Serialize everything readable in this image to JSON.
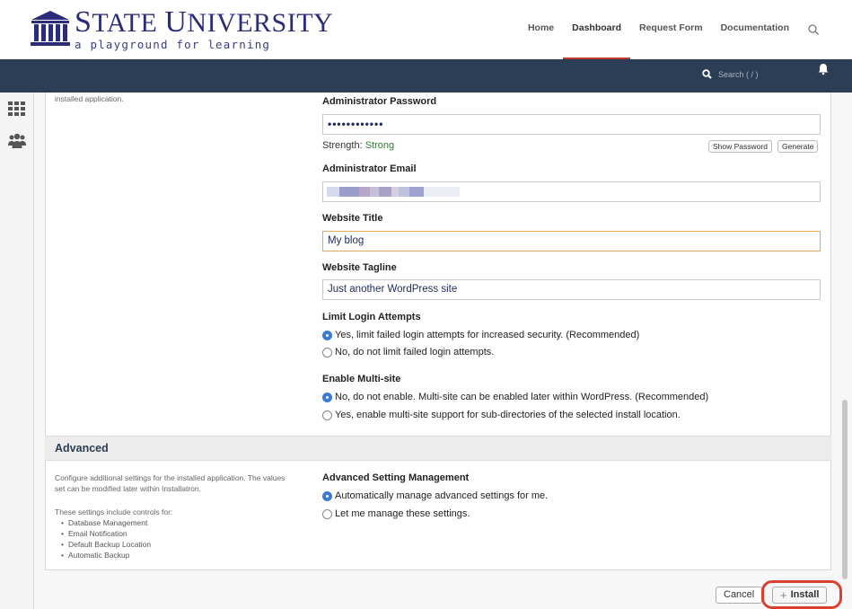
{
  "header": {
    "logo_title_first_big": "S",
    "logo_title_first_rest": "TATE ",
    "logo_title_second_big": "U",
    "logo_title_second_rest": "NIVERSITY",
    "logo_subtitle": "a playground for learning",
    "nav": [
      "Home",
      "Dashboard",
      "Request Form",
      "Documentation"
    ],
    "active_nav": "Dashboard"
  },
  "toolbar": {
    "search_label": "Search ( / )"
  },
  "form": {
    "top_left_note": "installed application.",
    "admin_password_label": "Administrator Password",
    "admin_password_value": "••••••••••••",
    "strength_prefix": "Strength:",
    "strength_value": "Strong",
    "show_password_label": "Show Password",
    "generate_label": "Generate",
    "admin_email_label": "Administrator Email",
    "website_title_label": "Website Title",
    "website_title_value": "My blog",
    "website_tagline_label": "Website Tagline",
    "website_tagline_value": "Just another WordPress site",
    "limit_login_label": "Limit Login Attempts",
    "limit_login_options": [
      "Yes, limit failed login attempts for increased security. (Recommended)",
      "No, do not limit failed login attempts."
    ],
    "multisite_label": "Enable Multi-site",
    "multisite_options": [
      "No, do not enable. Multi-site can be enabled later within WordPress. (Recommended)",
      "Yes, enable multi-site support for sub-directories of the selected install location."
    ]
  },
  "advanced": {
    "title": "Advanced",
    "desc_line1": "Configure additional settings for the installed application. The values",
    "desc_line2": "set can be modified later within Installatron.",
    "controls_intro": "These settings include controls for:",
    "controls": [
      "Database Management",
      "Email Notification",
      "Default Backup Location",
      "Automatic Backup"
    ],
    "management_label": "Advanced Setting Management",
    "management_options": [
      "Automatically manage advanced settings for me.",
      "Let me manage these settings."
    ]
  },
  "actions": {
    "cancel_label": "Cancel",
    "install_label": "Install"
  },
  "colors": {
    "brand": "#2b2d7a",
    "darkbar": "#2c3e55",
    "active_accent": "#c0392b",
    "highlight_ring": "#d9412f",
    "radio_selected": "#3b7bd4"
  }
}
